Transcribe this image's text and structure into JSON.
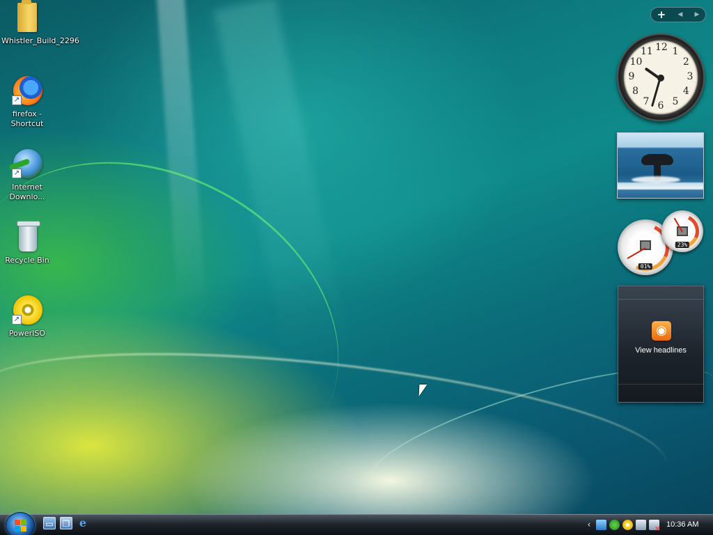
{
  "desktop": {
    "icons": [
      {
        "label": "Whistler_Build_2296",
        "icon": "folder-icon",
        "shortcut": false
      },
      {
        "label": "firefox - Shortcut",
        "icon": "firefox-icon",
        "shortcut": true
      },
      {
        "label": "Internet Downlo...",
        "icon": "internet-download-manager-icon",
        "shortcut": true
      },
      {
        "label": "Recycle Bin",
        "icon": "recycle-bin-icon",
        "shortcut": false
      },
      {
        "label": "PowerISO",
        "icon": "poweriso-disc-icon",
        "shortcut": true
      }
    ]
  },
  "sidebar": {
    "controls": {
      "add": "+",
      "prev": "◀",
      "next": "▶"
    },
    "clock": {
      "numerals": [
        "12",
        "1",
        "2",
        "3",
        "4",
        "5",
        "6",
        "7",
        "8",
        "9",
        "10",
        "11"
      ],
      "time_shown": "10:36"
    },
    "cpu_meter": {
      "cpu_value": "01%",
      "memory_value": "23%"
    },
    "feed_headlines": {
      "label": "View headlines",
      "icon": "rss-feed-icon"
    }
  },
  "taskbar": {
    "start_icon": "windows-start-orb-icon",
    "quick_launch": [
      {
        "name": "show-desktop-icon",
        "glyph": "▭"
      },
      {
        "name": "switch-windows-icon",
        "glyph": "❐"
      },
      {
        "name": "internet-explorer-icon",
        "glyph": "e"
      }
    ],
    "tray": {
      "chevron": "‹",
      "clock": "10:36 AM"
    }
  },
  "colors": {
    "taskbar": "#1f252c",
    "start_orb": "#2e79c8",
    "rss_orange": "#e86a10"
  }
}
